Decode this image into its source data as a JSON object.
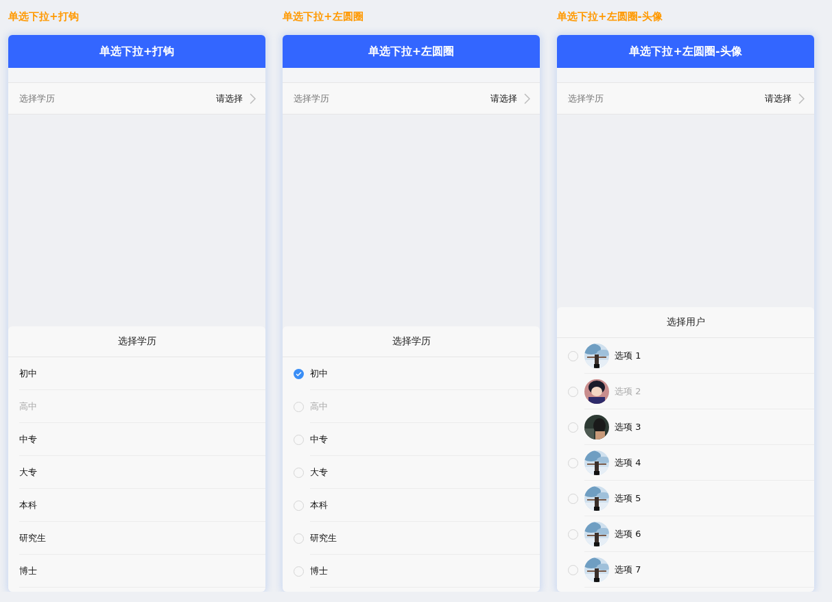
{
  "demos": [
    {
      "kind": "tick",
      "heading": "单选下拉+打钩",
      "navbar_title": "单选下拉+打钩",
      "field": {
        "label": "选择学历",
        "value": "请选择"
      },
      "sheet": {
        "title": "选择学历",
        "options": [
          {
            "label": "初中",
            "selected": false,
            "disabled": false
          },
          {
            "label": "高中",
            "selected": false,
            "disabled": true
          },
          {
            "label": "中专",
            "selected": false,
            "disabled": false
          },
          {
            "label": "大专",
            "selected": false,
            "disabled": false
          },
          {
            "label": "本科",
            "selected": false,
            "disabled": false
          },
          {
            "label": "研究生",
            "selected": false,
            "disabled": false
          },
          {
            "label": "博士",
            "selected": false,
            "disabled": false
          }
        ]
      }
    },
    {
      "kind": "circle",
      "heading": "单选下拉+左圆圈",
      "navbar_title": "单选下拉+左圆圈",
      "field": {
        "label": "选择学历",
        "value": "请选择"
      },
      "sheet": {
        "title": "选择学历",
        "options": [
          {
            "label": "初中",
            "selected": true,
            "disabled": false
          },
          {
            "label": "高中",
            "selected": false,
            "disabled": true
          },
          {
            "label": "中专",
            "selected": false,
            "disabled": false
          },
          {
            "label": "大专",
            "selected": false,
            "disabled": false
          },
          {
            "label": "本科",
            "selected": false,
            "disabled": false
          },
          {
            "label": "研究生",
            "selected": false,
            "disabled": false
          },
          {
            "label": "博士",
            "selected": false,
            "disabled": false
          }
        ]
      }
    },
    {
      "kind": "avatar",
      "heading": "单选下拉+左圆圈-头像",
      "navbar_title": "单选下拉+左圆圈-头像",
      "field": {
        "label": "选择学历",
        "value": "请选择"
      },
      "sheet": {
        "title": "选择用户",
        "options": [
          {
            "label": "选项 1",
            "selected": false,
            "disabled": false
          },
          {
            "label": "选项 2",
            "selected": false,
            "disabled": true
          },
          {
            "label": "选项 3",
            "selected": false,
            "disabled": false
          },
          {
            "label": "选项 4",
            "selected": false,
            "disabled": false
          },
          {
            "label": "选项 5",
            "selected": false,
            "disabled": false
          },
          {
            "label": "选项 6",
            "selected": false,
            "disabled": false
          },
          {
            "label": "选项 7",
            "selected": false,
            "disabled": false
          }
        ]
      }
    }
  ]
}
